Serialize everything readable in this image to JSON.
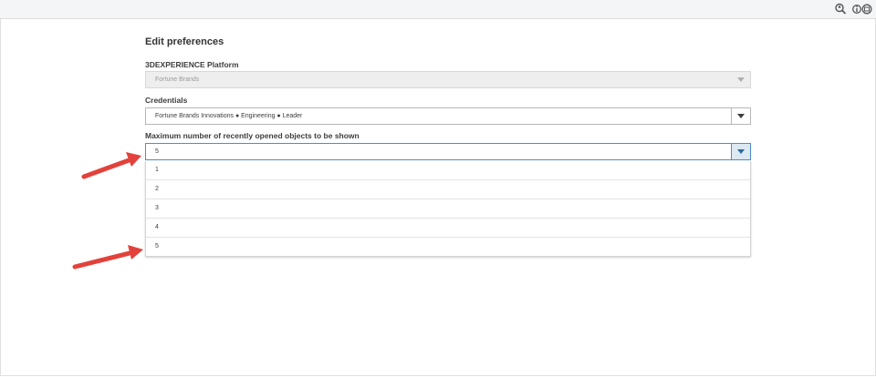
{
  "page": {
    "title": "Edit preferences"
  },
  "topbar": {
    "icons": [
      "search-user-icon",
      "info-icon",
      "compass-icon"
    ]
  },
  "platform": {
    "label": "3DEXPERIENCE Platform",
    "value": "Fortune Brands",
    "disabled": true
  },
  "credentials": {
    "label": "Credentials",
    "value": "Fortune Brands Innovations ● Engineering ● Leader"
  },
  "max_recent": {
    "label": "Maximum number of recently opened objects to be shown",
    "value": "5",
    "options": [
      "1",
      "2",
      "3",
      "4",
      "5"
    ]
  },
  "annotations": {
    "arrow_color": "#e2423b"
  }
}
